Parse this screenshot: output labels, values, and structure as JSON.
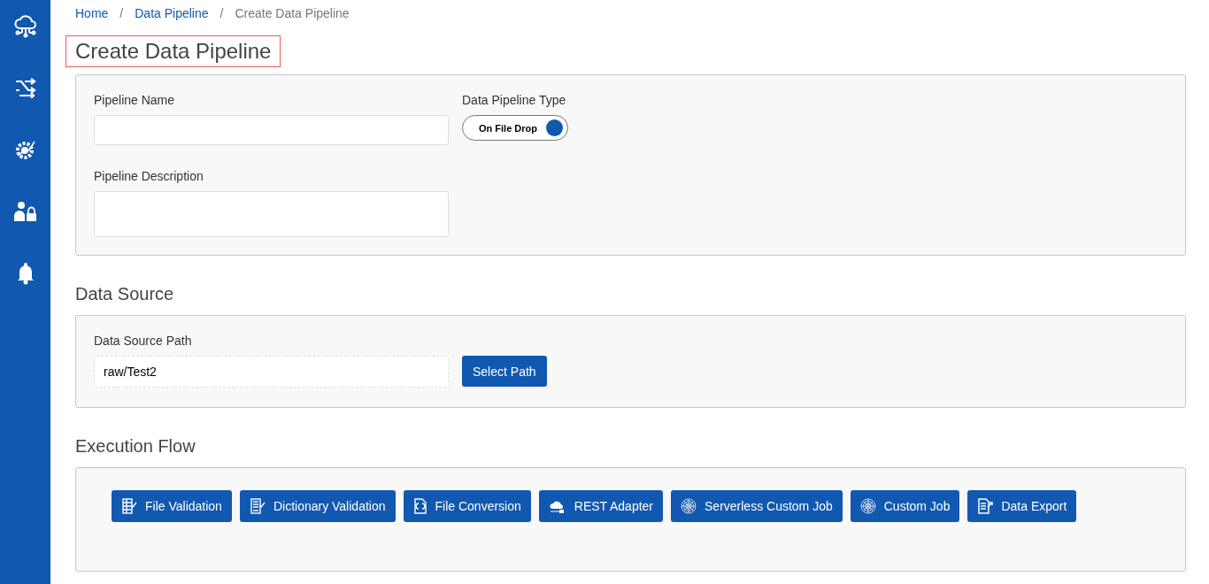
{
  "sidebar": {
    "items": [
      {
        "kind": "cloud"
      },
      {
        "kind": "shuffle"
      },
      {
        "kind": "gear"
      },
      {
        "kind": "user-lock"
      },
      {
        "kind": "bell"
      }
    ]
  },
  "breadcrumb": [
    {
      "label": "Home",
      "current": false
    },
    {
      "label": "Data Pipeline",
      "current": false
    },
    {
      "label": "Create Data Pipeline",
      "current": true
    }
  ],
  "breadcrumb_separator": "/",
  "title": "Create Data Pipeline",
  "pipeline_form": {
    "name_label": "Pipeline Name",
    "description_label": "Pipeline Description",
    "type_label": "Data Pipeline Type",
    "type_toggle": {
      "label": "On File Drop",
      "on": true
    }
  },
  "data_source": {
    "heading": "Data Source",
    "path_label": "Data Source Path",
    "path_value": "raw/Test2",
    "select_button": "Select Path"
  },
  "execution_flow": {
    "heading": "Execution Flow",
    "jobs": [
      {
        "label": "File Validation",
        "kind": "table-check"
      },
      {
        "label": "Dictionary Validation",
        "kind": "list-check"
      },
      {
        "label": "File Conversion",
        "kind": "doc-convert"
      },
      {
        "label": "REST Adapter",
        "kind": "rest"
      },
      {
        "label": "Serverless Custom Job",
        "kind": "target"
      },
      {
        "label": "Custom Job",
        "kind": "target"
      },
      {
        "label": "Data Export",
        "kind": "doc-export"
      }
    ]
  }
}
